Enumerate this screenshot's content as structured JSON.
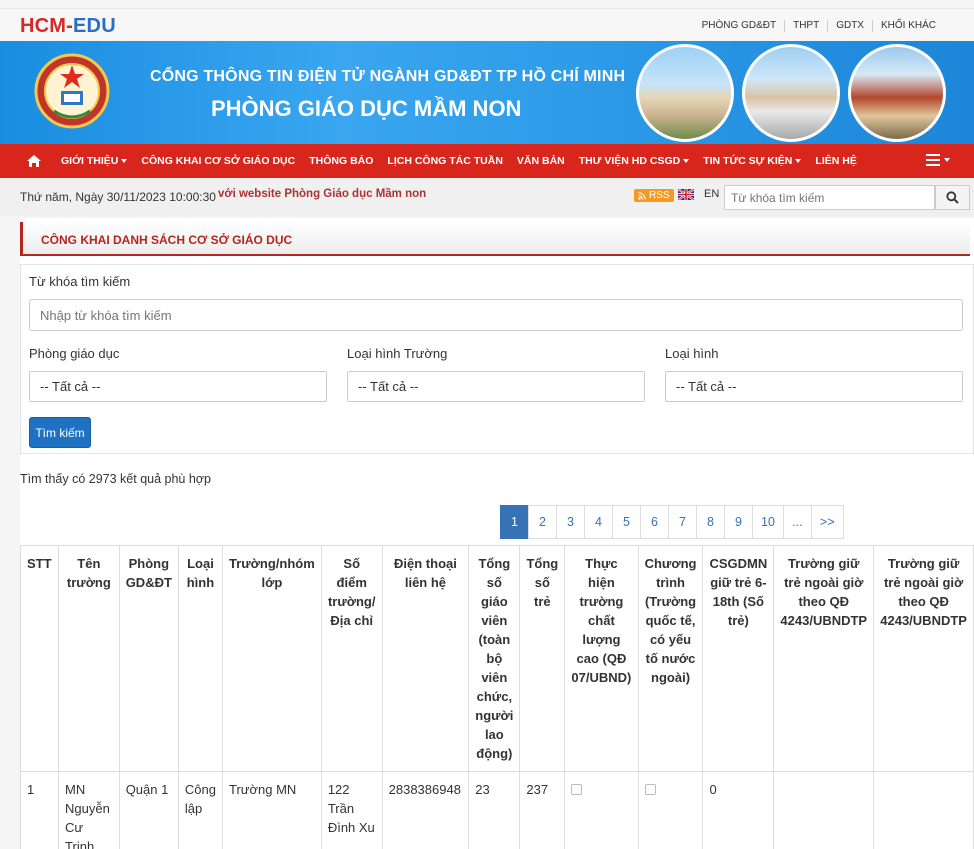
{
  "site": {
    "logo_part1": "HCM-",
    "logo_part2": "EDU"
  },
  "top_links": [
    "PHÒNG GD&ĐT",
    "THPT",
    "GDTX",
    "KHỐI KHÁC"
  ],
  "banner": {
    "line1": "CỔNG THÔNG TIN ĐIỆN TỬ NGÀNH GD&ĐT TP HỒ CHÍ MINH",
    "line2": "PHÒNG GIÁO DỤC MẦM NON"
  },
  "nav": {
    "items": [
      {
        "label": "GIỚI THIỆU",
        "dropdown": true
      },
      {
        "label": "CÔNG KHAI CƠ SỞ GIÁO DỤC",
        "dropdown": false
      },
      {
        "label": "THÔNG BÁO",
        "dropdown": false
      },
      {
        "label": "LỊCH CÔNG TÁC TUẦN",
        "dropdown": false
      },
      {
        "label": "VĂN BẢN",
        "dropdown": false
      },
      {
        "label": "THƯ VIỆN HD CSGD",
        "dropdown": true
      },
      {
        "label": "TIN TỨC SỰ KIỆN",
        "dropdown": true
      },
      {
        "label": "LIÊN HỆ",
        "dropdown": false
      }
    ]
  },
  "info": {
    "datetime": "Thứ năm, Ngày 30/11/2023 10:00:30",
    "marquee": "với website Phòng Giáo dục Mầm non",
    "rss": "RSS",
    "lang": "EN",
    "search_placeholder": "Từ khóa tìm kiếm"
  },
  "section": {
    "title": "CÔNG KHAI DANH SÁCH CƠ SỞ GIÁO DỤC"
  },
  "filters": {
    "keyword_label": "Từ khóa tìm kiếm",
    "keyword_placeholder": "Nhập từ khóa tìm kiếm",
    "office_label": "Phòng giáo dục",
    "office_value": "-- Tất cả --",
    "school_type_label": "Loại hình Trường",
    "school_type_value": "-- Tất cả --",
    "type_label": "Loại hình",
    "type_value": "-- Tất cả --",
    "search_button": "Tìm kiếm"
  },
  "result_text": "Tìm thấy có 2973 kết quả phù hợp",
  "pagination": [
    "1",
    "2",
    "3",
    "4",
    "5",
    "6",
    "7",
    "8",
    "9",
    "10",
    "...",
    ">>"
  ],
  "table": {
    "headers": [
      "STT",
      "Tên trường",
      "Phòng GD&ĐT",
      "Loại hình",
      "Trường/nhóm lớp",
      "Số điểm trường/ Địa chỉ",
      "Điện thoại liên hệ",
      "Tổng số giáo viên (toàn bộ viên chức, người lao động)",
      "Tổng số trẻ",
      "Thực hiện trường chất lượng cao (QĐ 07/UBND)",
      "Chương trình (Trường quốc tế, có yếu tố nước ngoài)",
      "CSGDMN giữ trẻ 6-18th (Số trẻ)",
      "Trường giữ trẻ ngoài giờ theo QĐ 4243/UBNDTP",
      "Trường giữ trẻ ngoài giờ theo QĐ 4243/UBNDTP"
    ],
    "rows": [
      {
        "stt": "1",
        "name": "MN Nguyễn Cư Trinh",
        "office": "Quận 1",
        "type": "Công lập",
        "kind": "Trường MN",
        "address": "122 Trần Đình Xu",
        "phone": "2838386948",
        "teachers": "23",
        "children": "237",
        "high_quality": false,
        "international": false,
        "daycare": "0",
        "after_hours_1": "",
        "after_hours_2": ""
      }
    ]
  },
  "colors": {
    "nav_red": "#d9261c",
    "banner_blue": "#2d9be8",
    "accent_blue": "#3572b6",
    "section_red": "#b3261e"
  }
}
